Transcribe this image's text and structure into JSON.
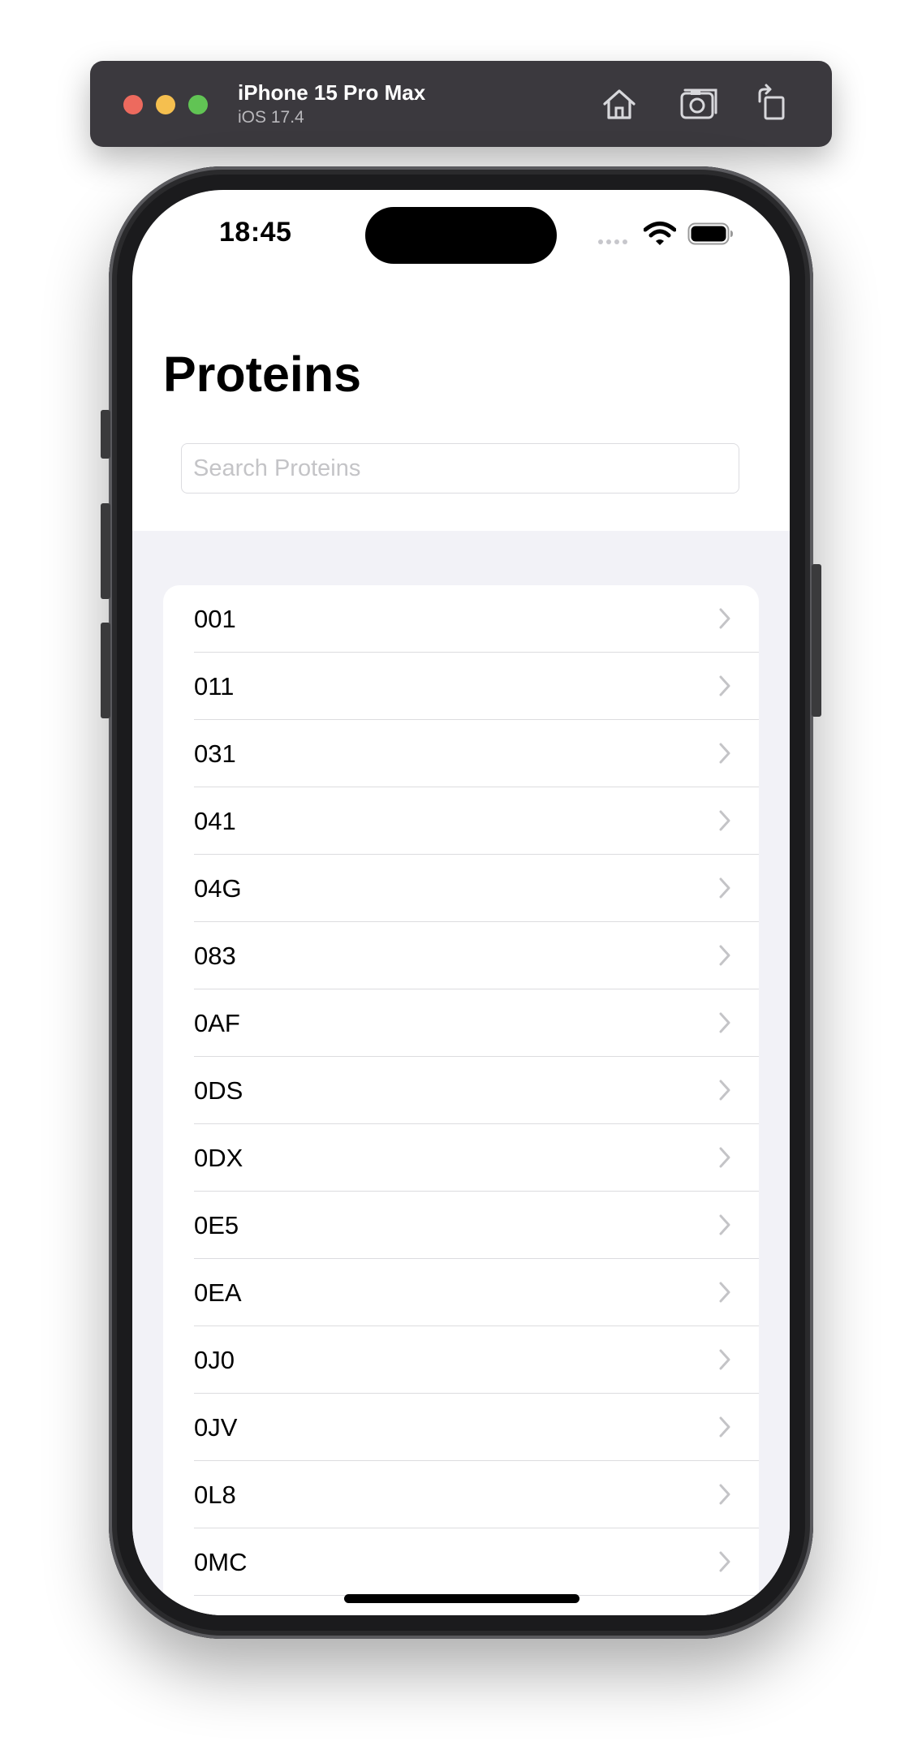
{
  "simulator": {
    "device_name": "iPhone 15 Pro Max",
    "os_version": "iOS 17.4",
    "toolbar_icons": [
      "home-icon",
      "screenshot-icon",
      "rotate-icon"
    ]
  },
  "status_bar": {
    "time": "18:45",
    "icons": [
      "cellular-signal-icon",
      "wifi-icon",
      "battery-icon"
    ]
  },
  "screen": {
    "title": "Proteins",
    "search": {
      "placeholder": "Search Proteins",
      "value": ""
    },
    "list": {
      "items": [
        {
          "label": "001"
        },
        {
          "label": "011"
        },
        {
          "label": "031"
        },
        {
          "label": "041"
        },
        {
          "label": "04G"
        },
        {
          "label": "083"
        },
        {
          "label": "0AF"
        },
        {
          "label": "0DS"
        },
        {
          "label": "0DX"
        },
        {
          "label": "0E5"
        },
        {
          "label": "0EA"
        },
        {
          "label": "0J0"
        },
        {
          "label": "0JV"
        },
        {
          "label": "0L8"
        },
        {
          "label": "0MC"
        },
        {
          "label": ""
        }
      ]
    }
  },
  "colors": {
    "title_bar": "#3b393e",
    "grouped_background": "#f2f2f7",
    "separator": "#dcdcdf",
    "chevron": "#c4c4c7"
  }
}
